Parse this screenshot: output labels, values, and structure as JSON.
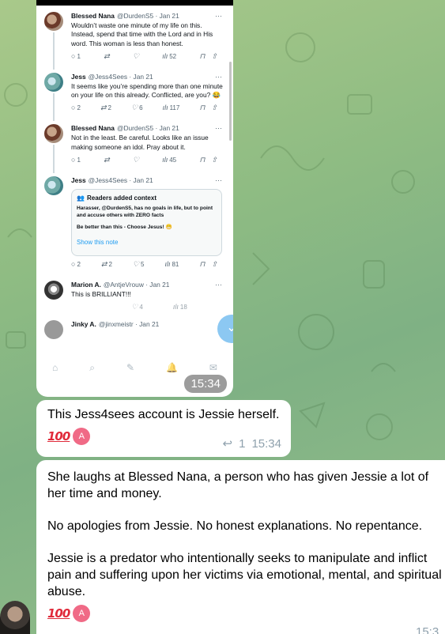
{
  "screenshot": {
    "time": "15:34",
    "tweets": [
      {
        "name": "Blessed Nana",
        "handle": "@DurdenS5 · Jan 21",
        "text": "Wouldn’t waste one minute of my life on this. Instead, spend that time with the Lord and in His word. This woman is less than honest.",
        "replies": "1",
        "retweets": "",
        "likes": "",
        "views": "52"
      },
      {
        "name": "Jess",
        "handle": "@Jess4Sees · Jan 21",
        "text": "It seems like you’re spending more than one minute on your life on this already. Conflicted, are you? 😂",
        "replies": "2",
        "retweets": "2",
        "likes": "6",
        "views": "117"
      },
      {
        "name": "Blessed Nana",
        "handle": "@DurdenS5 · Jan 21",
        "text": "Not in the least. Be careful. Looks like an issue making someone an idol. Pray about it.",
        "replies": "1",
        "retweets": "",
        "likes": "",
        "views": "45"
      },
      {
        "name": "Jess",
        "handle": "@Jess4Sees · Jan 21",
        "context_title": "Readers added context",
        "context_text_1": "Harasser, @DurdenS5, has no goals in life, but to point and accuse others with ZERO facts",
        "context_text_2": "Be better than this - Choose Jesus! 😁",
        "context_link": "Show this note",
        "replies": "2",
        "retweets": "2",
        "likes": "5",
        "views": "81"
      },
      {
        "name": "Marion A.",
        "handle": "@AntjeVrouw · Jan 21",
        "text": "This is BRILLIANT!!!",
        "likes": "4",
        "views": "18"
      },
      {
        "name": "Jinky A.",
        "handle": "@jinxmeistr · Jan 21"
      }
    ],
    "icons": {
      "reply": "reply-icon",
      "retweet": "retweet-icon",
      "like": "heart-icon",
      "views": "views-icon",
      "bookmark": "bookmark-icon",
      "share": "share-icon"
    }
  },
  "messages": [
    {
      "text": "This Jess4sees account is Jessie herself.",
      "reaction": "💯",
      "reaction_avatar": "A",
      "reply_count": "1",
      "time": "15:34"
    },
    {
      "paragraphs": [
        "She laughs at Blessed Nana, a person who has given Jessie a lot of her time and money.",
        "No apologies from Jessie. No honest explanations. No repentance.",
        "Jessie is a predator who intentionally seeks to manipulate and inflict pain and suffering upon her victims via emotional, mental, and spiritual abuse."
      ],
      "reaction": "💯",
      "reaction_avatar": "A",
      "time": "15:3"
    }
  ],
  "colors": {
    "background": "#8fbc83",
    "link": "#1d9bf0",
    "reaction_avatar": "#f06a86",
    "meta": "#8fa1ad"
  }
}
